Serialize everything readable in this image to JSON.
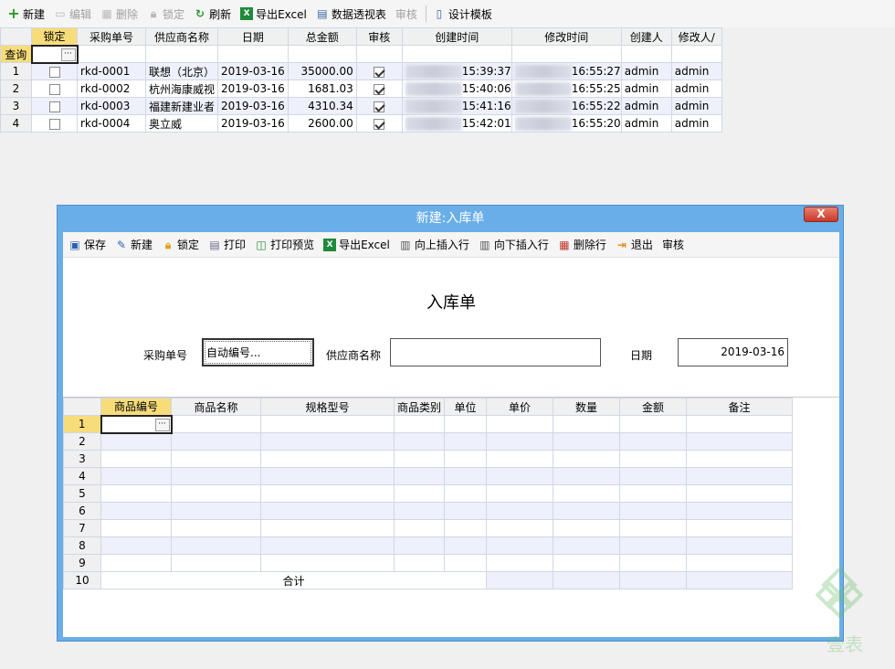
{
  "toolbar": {
    "items": [
      {
        "label": "新建",
        "icon": "plus-icon",
        "disabled": false
      },
      {
        "label": "编辑",
        "icon": "folder-icon",
        "disabled": true
      },
      {
        "label": "删除",
        "icon": "grid-delete-icon",
        "disabled": true
      },
      {
        "label": "锁定",
        "icon": "lock-icon",
        "disabled": true
      },
      {
        "label": "刷新",
        "icon": "refresh-icon",
        "disabled": false
      },
      {
        "label": "导出Excel",
        "icon": "excel-icon",
        "disabled": false
      },
      {
        "label": "数据透视表",
        "icon": "pivot-icon",
        "disabled": false
      },
      {
        "label": "审核",
        "icon": "",
        "disabled": true
      },
      {
        "label": "设计模板",
        "icon": "template-icon",
        "disabled": false
      }
    ]
  },
  "grid": {
    "headers": [
      "锁定",
      "采购单号",
      "供应商名称",
      "日期",
      "总金额",
      "审核",
      "创建时间",
      "修改时间",
      "创建人",
      "修改人/"
    ],
    "query_label": "查询",
    "rows": [
      {
        "num": "1",
        "no": "rkd-0001",
        "supplier": "联想（北京）",
        "date": "2019-03-16",
        "amount": "35000.00",
        "ctime": "15:39:37",
        "mtime": "16:55:27",
        "creator": "admin",
        "modifier": "admin"
      },
      {
        "num": "2",
        "no": "rkd-0002",
        "supplier": "杭州海康威视",
        "date": "2019-03-16",
        "amount": "1681.03",
        "ctime": "15:40:06",
        "mtime": "16:55:25",
        "creator": "admin",
        "modifier": "admin"
      },
      {
        "num": "3",
        "no": "rkd-0003",
        "supplier": " 福建新建业者",
        "date": "2019-03-16",
        "amount": "4310.34",
        "ctime": "15:41:16",
        "mtime": "16:55:22",
        "creator": "admin",
        "modifier": "admin"
      },
      {
        "num": "4",
        "no": "rkd-0004",
        "supplier": "奥立威",
        "date": "2019-03-16",
        "amount": "2600.00",
        "ctime": "15:42:01",
        "mtime": "16:55:20",
        "creator": "admin",
        "modifier": "admin"
      }
    ]
  },
  "dialog": {
    "title": "新建:入库单",
    "close_label": "X",
    "toolbar": [
      {
        "label": "保存",
        "icon": "save-icon"
      },
      {
        "label": "新建",
        "icon": "new-icon"
      },
      {
        "label": "锁定",
        "icon": "lock-icon"
      },
      {
        "label": "打印",
        "icon": "print-icon"
      },
      {
        "label": "打印预览",
        "icon": "print-preview-icon"
      },
      {
        "label": "导出Excel",
        "icon": "excel-icon"
      },
      {
        "label": "向上插入行",
        "icon": "insert-up-icon"
      },
      {
        "label": "向下插入行",
        "icon": "insert-down-icon"
      },
      {
        "label": "删除行",
        "icon": "delete-row-icon"
      },
      {
        "label": "退出",
        "icon": "exit-icon"
      },
      {
        "label": "审核",
        "icon": ""
      }
    ],
    "form": {
      "title": "入库单",
      "order_no_label": "采购单号",
      "order_no_value": "自动编号...",
      "supplier_label": "供应商名称",
      "supplier_value": "",
      "date_label": "日期",
      "date_value": "2019-03-16"
    },
    "detail": {
      "headers": [
        "商品编号",
        "商品名称",
        "规格型号",
        "商品类别",
        "单位",
        "单价",
        "数量",
        "金额",
        "备注"
      ],
      "row_numbers": [
        "1",
        "2",
        "3",
        "4",
        "5",
        "6",
        "7",
        "8",
        "9"
      ],
      "total_row_number": "10",
      "total_label": "合计"
    }
  }
}
